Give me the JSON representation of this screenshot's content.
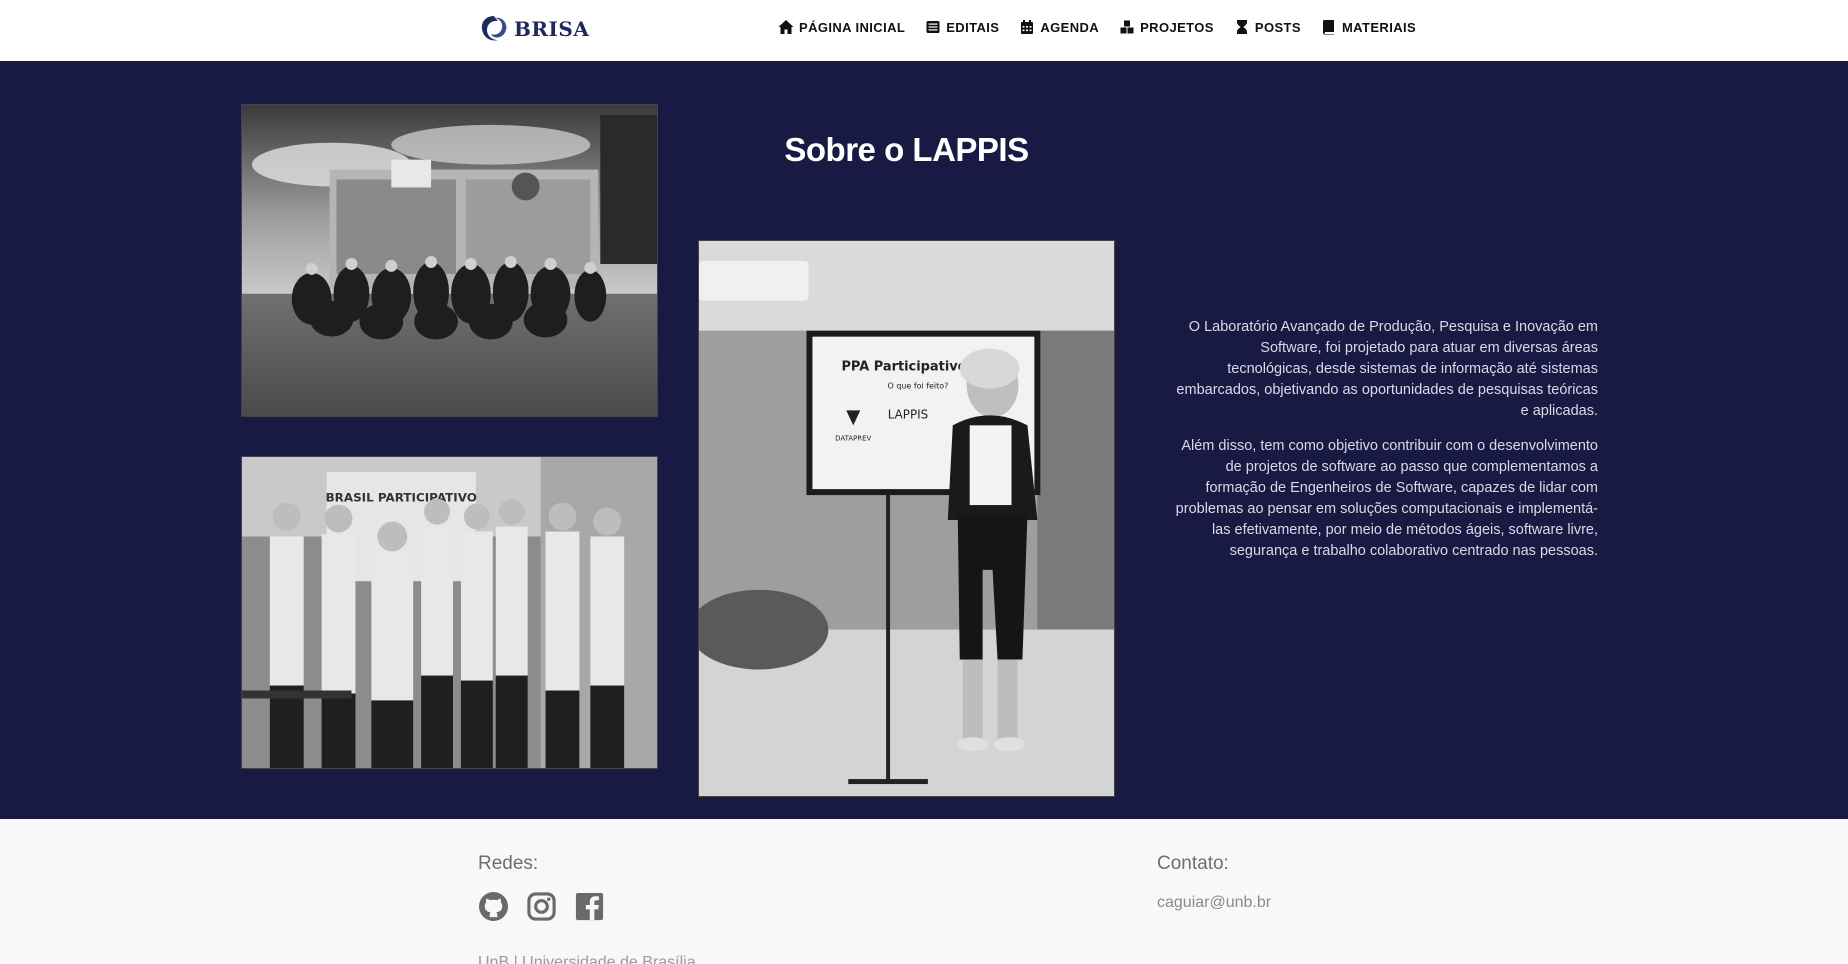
{
  "brand": {
    "name": "BRISA",
    "icon": "brisa-swirl-logo"
  },
  "nav": {
    "items": [
      {
        "label": "PÁGINA INICIAL",
        "icon": "home-icon"
      },
      {
        "label": "EDITAIS",
        "icon": "list-icon"
      },
      {
        "label": "AGENDA",
        "icon": "calendar-icon"
      },
      {
        "label": "PROJETOS",
        "icon": "cubes-icon"
      },
      {
        "label": "POSTS",
        "icon": "hourglass-icon"
      },
      {
        "label": "MATERIAIS",
        "icon": "book-icon"
      }
    ]
  },
  "about": {
    "title": "Sobre o LAPPIS",
    "paragraphs": [
      "O Laboratório Avançado de Produção, Pesquisa e Inovação em Software, foi projetado para atuar em diversas áreas tecnológicas, desde sistemas de informação até sistemas embarcados, objetivando as oportunidades de pesquisas teóricas e aplicadas.",
      "Além disso, tem como objetivo contribuir com o desenvolvimento de projetos de software ao passo que complementamos a formação de Engenheiros de Software, capazes de lidar com problemas ao pensar em soluções computacionais e implementá-las efetivamente, por meio de métodos ágeis, software livre, segurança e trabalho colaborativo centrado nas pessoas."
    ],
    "slide": {
      "heading": "PPA Participativo",
      "subheading": "O que foi feito?",
      "logo1": "DATAPREV",
      "logo2": "LAPPIS"
    },
    "banner": "BRASIL PARTICIPATIVO"
  },
  "footer": {
    "redes_label": "Redes:",
    "contato_label": "Contato:",
    "email": "caguiar@unb.br",
    "university": "UnB | Universidade de Brasília",
    "social": [
      "github-icon",
      "instagram-icon",
      "facebook-icon"
    ]
  },
  "colors": {
    "navy": "#181a44",
    "brand": "#1f2a5c",
    "footer_bg": "#f8f8f8"
  }
}
